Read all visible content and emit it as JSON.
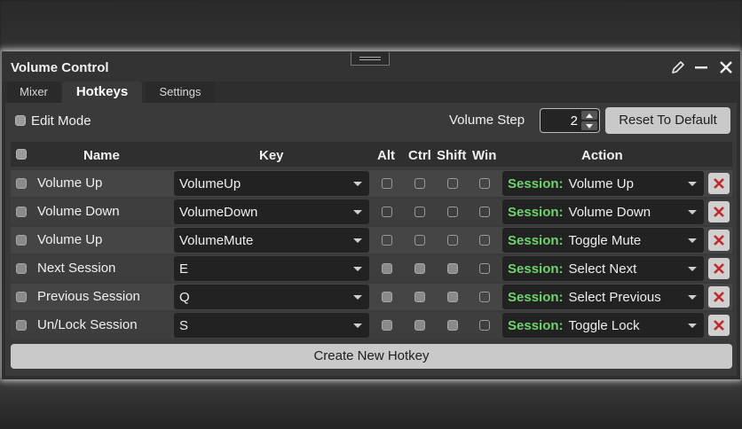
{
  "window": {
    "title": "Volume Control"
  },
  "tabs": [
    {
      "label": "Mixer",
      "active": false
    },
    {
      "label": "Hotkeys",
      "active": true
    },
    {
      "label": "Settings",
      "active": false
    }
  ],
  "toolbar": {
    "edit_mode_label": "Edit Mode",
    "volume_step_label": "Volume Step",
    "volume_step_value": "2",
    "reset_label": "Reset To Default"
  },
  "table": {
    "headers": {
      "name": "Name",
      "key": "Key",
      "alt": "Alt",
      "ctrl": "Ctrl",
      "shift": "Shift",
      "win": "Win",
      "action": "Action"
    },
    "rows": [
      {
        "name": "Volume Up",
        "key": "VolumeUp",
        "alt": false,
        "ctrl": false,
        "shift": false,
        "win": false,
        "action_prefix": "Session:",
        "action": "Volume Up"
      },
      {
        "name": "Volume Down",
        "key": "VolumeDown",
        "alt": false,
        "ctrl": false,
        "shift": false,
        "win": false,
        "action_prefix": "Session:",
        "action": "Volume Down"
      },
      {
        "name": "Volume Up",
        "key": "VolumeMute",
        "alt": false,
        "ctrl": false,
        "shift": false,
        "win": false,
        "action_prefix": "Session:",
        "action": "Toggle Mute"
      },
      {
        "name": "Next Session",
        "key": "E",
        "alt": true,
        "ctrl": true,
        "shift": true,
        "win": false,
        "action_prefix": "Session:",
        "action": "Select Next"
      },
      {
        "name": "Previous Session",
        "key": "Q",
        "alt": true,
        "ctrl": true,
        "shift": true,
        "win": false,
        "action_prefix": "Session:",
        "action": "Select Previous"
      },
      {
        "name": "Un/Lock Session",
        "key": "S",
        "alt": true,
        "ctrl": true,
        "shift": true,
        "win": false,
        "action_prefix": "Session:",
        "action": "Toggle Lock"
      }
    ]
  },
  "create_label": "Create New Hotkey",
  "icons": {
    "edit": "pencil-icon",
    "minimize": "minimize-icon",
    "close": "close-icon",
    "delete": "delete-x-icon"
  },
  "colors": {
    "session_prefix": "#6fd26f",
    "delete_x": "#c0282d",
    "button_bg": "#c9c9c9"
  }
}
